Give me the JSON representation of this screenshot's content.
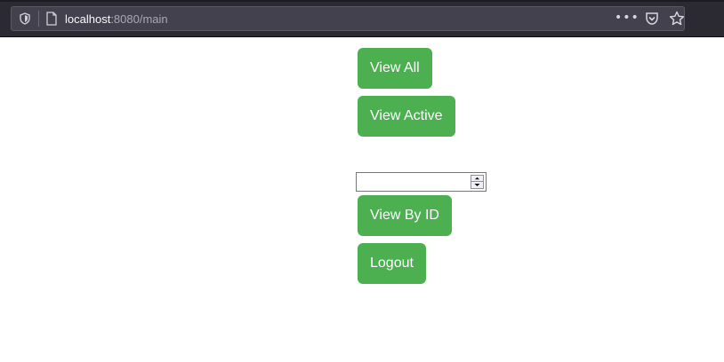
{
  "browser": {
    "url_host": "localhost",
    "url_rest": ":8080/main",
    "more_label": "•••",
    "icons": {
      "tracking": "shield-icon",
      "page": "page-icon",
      "pocket": "pocket-icon",
      "bookmark": "star-icon"
    }
  },
  "buttons": {
    "view_all": "View All",
    "view_active": "View Active",
    "view_by_id": "View By ID",
    "logout": "Logout"
  },
  "id_input": {
    "value": "",
    "placeholder": ""
  },
  "colors": {
    "button_bg": "#4caf50",
    "button_text": "#ffffff",
    "toolbar_bg": "#2b2a33"
  }
}
